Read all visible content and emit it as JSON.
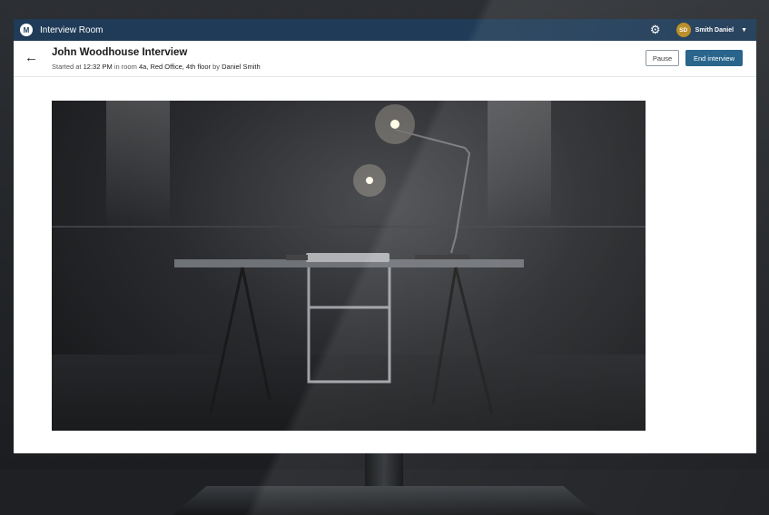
{
  "app": {
    "title": "Interview Room"
  },
  "user": {
    "initials": "SD",
    "name": "Smith Daniel"
  },
  "header": {
    "title": "John Woodhouse Interview",
    "started_label": "Started at",
    "time": "12:32 PM",
    "room_label": "in room",
    "room": "4a, Red Office, 4th floor",
    "by_label": "by",
    "by": "Daniel Smith"
  },
  "actions": {
    "pause": "Pause",
    "end": "End interview"
  },
  "icons": {
    "logo": "logo-icon",
    "settings": "gear-icon",
    "user_menu": "chevron-down-icon",
    "back": "back-arrow-icon"
  },
  "colors": {
    "appbar": "#1f3b57",
    "primary_button": "#1f5d86",
    "avatar": "#b68a1e"
  }
}
